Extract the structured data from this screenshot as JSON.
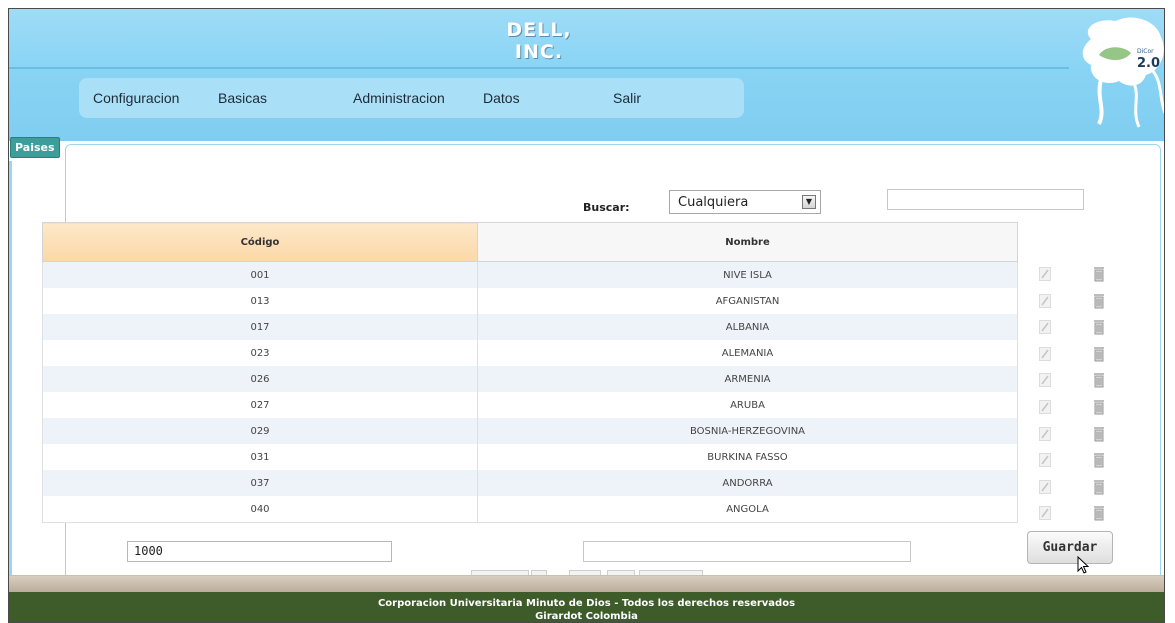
{
  "header": {
    "site_title": "DELL, INC.",
    "logo_text_top": "DiCor",
    "logo_text_bottom": "2.0"
  },
  "nav": {
    "items": [
      {
        "label": "Configuracion"
      },
      {
        "label": "Basicas"
      },
      {
        "label": "Administracion"
      },
      {
        "label": "Datos"
      },
      {
        "label": "Salir"
      }
    ]
  },
  "tab": {
    "label": "Paises"
  },
  "search": {
    "label": "Buscar:",
    "field_selected": "Cualquiera",
    "query_value": ""
  },
  "table": {
    "columns": [
      "Código",
      "Nombre"
    ],
    "rows": [
      {
        "codigo": "001",
        "nombre": "NIVE ISLA"
      },
      {
        "codigo": "013",
        "nombre": "AFGANISTAN"
      },
      {
        "codigo": "017",
        "nombre": "ALBANIA"
      },
      {
        "codigo": "023",
        "nombre": "ALEMANIA"
      },
      {
        "codigo": "026",
        "nombre": "ARMENIA"
      },
      {
        "codigo": "027",
        "nombre": "ARUBA"
      },
      {
        "codigo": "029",
        "nombre": "BOSNIA-HERZEGOVINA"
      },
      {
        "codigo": "031",
        "nombre": "BURKINA FASSO"
      },
      {
        "codigo": "037",
        "nombre": "ANDORRA"
      },
      {
        "codigo": "040",
        "nombre": "ANGOLA"
      }
    ]
  },
  "form": {
    "codigo_value": "1000",
    "nombre_value": "",
    "save_label": "Guardar"
  },
  "footer": {
    "line1": "Corporacion Universitaria Minuto de Dios - Todos los derechos reservados",
    "line2": "Girardot Colombia"
  },
  "colors": {
    "header_bg": "#89d4f5",
    "nav_bg": "#a9e0f7",
    "tab_bg": "#3b9e9b",
    "footer_bg": "#3d5c2a",
    "header_codigo_bg": "#fbd8a8"
  }
}
